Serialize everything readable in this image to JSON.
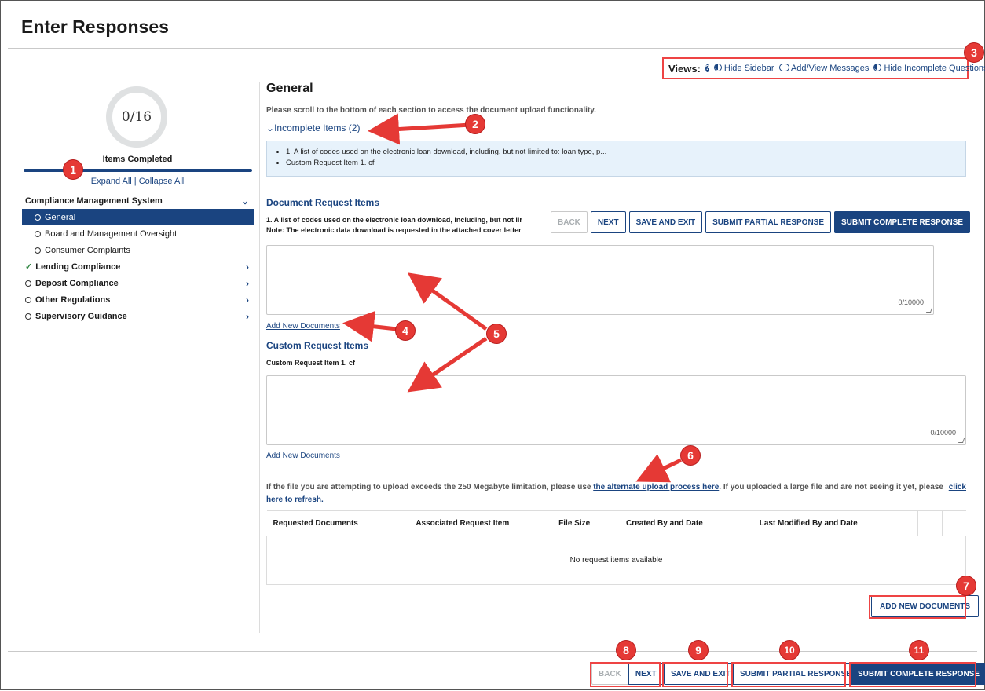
{
  "page": {
    "title": "Enter Responses"
  },
  "views": {
    "label": "Views:",
    "help": "?",
    "hide_sidebar": "Hide Sidebar",
    "add_view_messages": "Add/View Messages",
    "hide_incomplete": "Hide Incomplete Questions"
  },
  "sidebar": {
    "progress": "0/16",
    "progress_label": "Items Completed",
    "expand_all": "Expand All",
    "separator": " | ",
    "collapse_all": "Collapse All",
    "items": [
      {
        "label": "Compliance Management System"
      },
      {
        "label": "General"
      },
      {
        "label": "Board and Management Oversight"
      },
      {
        "label": "Consumer Complaints"
      },
      {
        "label": "Lending Compliance"
      },
      {
        "label": "Deposit Compliance"
      },
      {
        "label": "Other Regulations"
      },
      {
        "label": "Supervisory Guidance"
      }
    ]
  },
  "main": {
    "section_title": "General",
    "scroll_note": "Please scroll to the bottom of each section to access the document upload functionality.",
    "incomplete_toggle": "Incomplete Items (2)",
    "incomplete_items": [
      "1.  A list of codes used on the electronic loan download, including, but not limited to: loan type, p...",
      "Custom Request Item 1.  cf"
    ],
    "doc_heading": "Document Request Items",
    "doc_item_line1": "1.  A list of codes used on the electronic loan download, including, but not lir",
    "doc_item_line2": "Note: The electronic data download is requested in the attached cover letter",
    "doc_counter": "0/10000",
    "add_new_documents_link": "Add New Documents",
    "custom_heading": "Custom Request Items",
    "custom_item_label": "Custom Request Item 1. cf",
    "custom_counter": "0/10000",
    "add_new_documents_link2": "Add New Documents",
    "upload_note_pre": "If the file you are attempting to upload exceeds the 250 Megabyte limitation, please use ",
    "upload_note_link": "the alternate upload process here",
    "upload_note_mid": ". If you uploaded a large file and are not seeing it yet, please ",
    "upload_note_link2_a": "click",
    "upload_note_link2_b": "here to refresh.",
    "table": {
      "headers": [
        "Requested Documents",
        "Associated Request Item",
        "File Size",
        "Created By and Date",
        "Last Modified By and Date"
      ],
      "empty": "No request items available"
    },
    "add_new_documents_button": "ADD NEW DOCUMENTS"
  },
  "buttons": {
    "back": "BACK",
    "next": "NEXT",
    "save_exit": "SAVE AND EXIT",
    "submit_partial": "SUBMIT PARTIAL RESPONSE",
    "submit_complete": "SUBMIT COMPLETE RESPONSE"
  },
  "annotations": [
    "1",
    "2",
    "3",
    "4",
    "5",
    "6",
    "7",
    "8",
    "9",
    "10",
    "11"
  ],
  "colors": {
    "primary": "#1a4480",
    "annotation": "#e53935",
    "success": "#2e8540"
  }
}
